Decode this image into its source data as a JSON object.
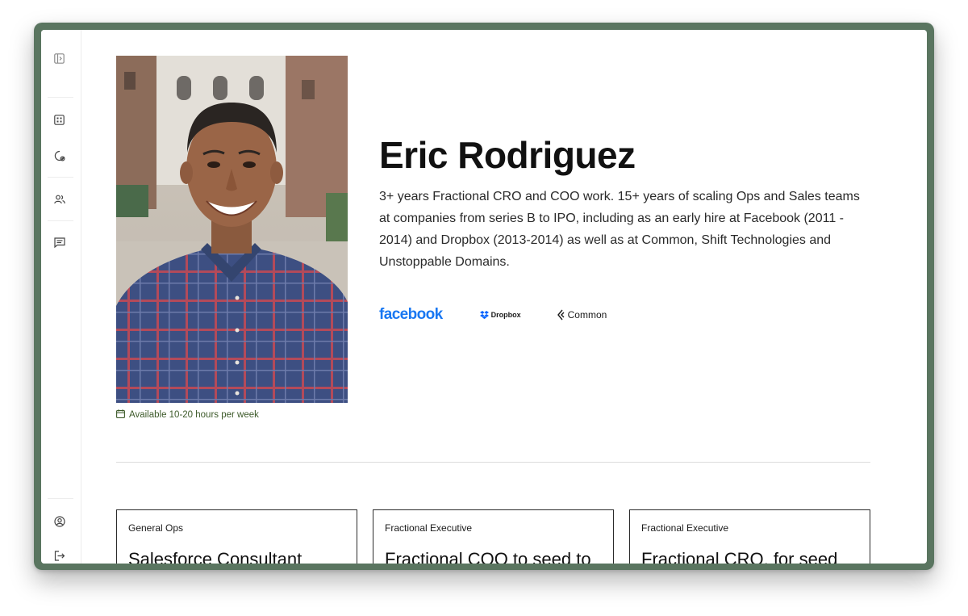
{
  "sidebar": {
    "icons": [
      "sidebar-toggle-icon",
      "grid-icon",
      "settings-badge-icon",
      "users-icon",
      "message-icon",
      "user-circle-icon",
      "logout-icon"
    ]
  },
  "profile": {
    "name": "Eric Rodriguez",
    "bio": "3+ years Fractional CRO and COO work. 15+ years of scaling Ops and Sales teams at companies from series B to IPO, including as an early hire at Facebook (2011 - 2014) and Dropbox (2013-2014) as well as at Common, Shift Technologies and Unstoppable Domains.",
    "availability": "Available 10-20 hours per week",
    "logos": {
      "facebook": "facebook",
      "dropbox": "Dropbox",
      "common": "Common"
    }
  },
  "colors": {
    "frame": "#5a7560",
    "availability": "#3d5a2a",
    "facebook": "#1877f2",
    "dropbox": "#0061fe"
  },
  "cards": [
    {
      "category": "General Ops",
      "title": "Salesforce Consultant"
    },
    {
      "category": "Fractional Executive",
      "title": "Fractional COO to seed to"
    },
    {
      "category": "Fractional Executive",
      "title": "Fractional CRO, for seed"
    }
  ]
}
